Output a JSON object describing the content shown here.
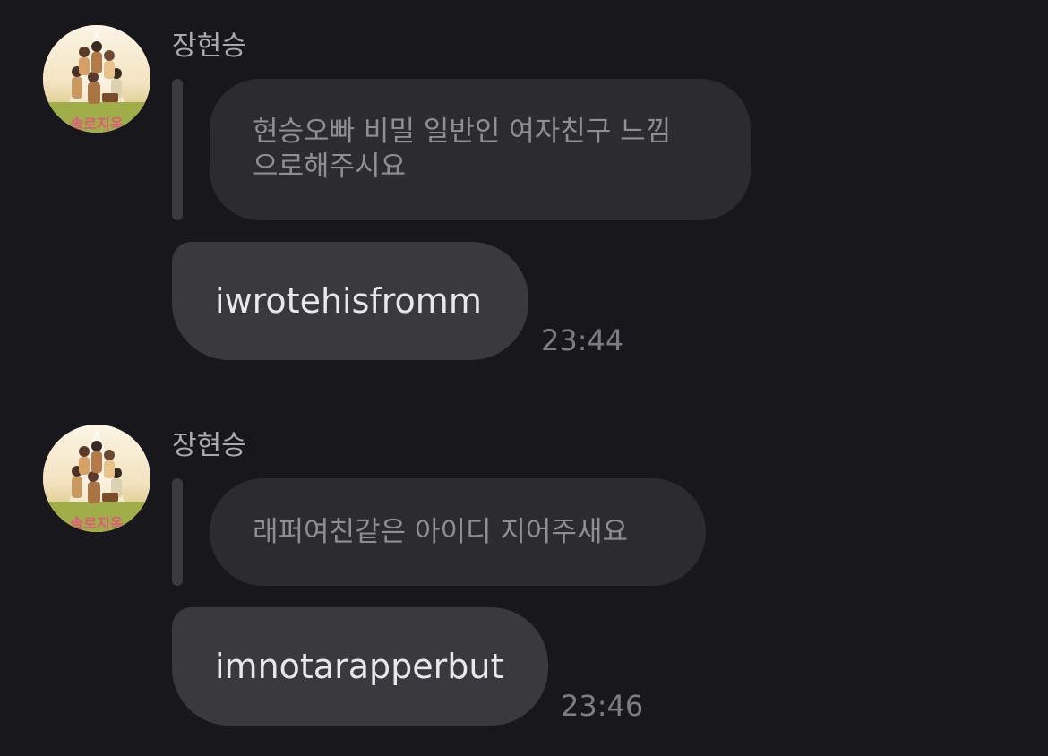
{
  "messages": [
    {
      "sender": "장현승",
      "avatar": "group-photo-avatar",
      "quoted_text": "현승오빠 비밀 일반인 여자친구 느낌으로해주시요",
      "quoted_lines": [
        "현승오빠 비밀 일반인 여자친구 느낌",
        "으로해주시요"
      ],
      "text": "iwrotehisfromm",
      "time": "23:44"
    },
    {
      "sender": "장현승",
      "avatar": "group-photo-avatar",
      "quoted_text": "래퍼여친같은 아이디 지어주새요",
      "quoted_lines": [
        "래퍼여친같은 아이디 지어주새요"
      ],
      "text": "imnotarapperbut",
      "time": "23:46"
    }
  ],
  "colors": {
    "background": "#18181c",
    "quote_bubble": "#2c2c30",
    "message_bubble": "#39393e",
    "muted_text": "#8e8e93",
    "primary_text": "#e8e8ea"
  }
}
